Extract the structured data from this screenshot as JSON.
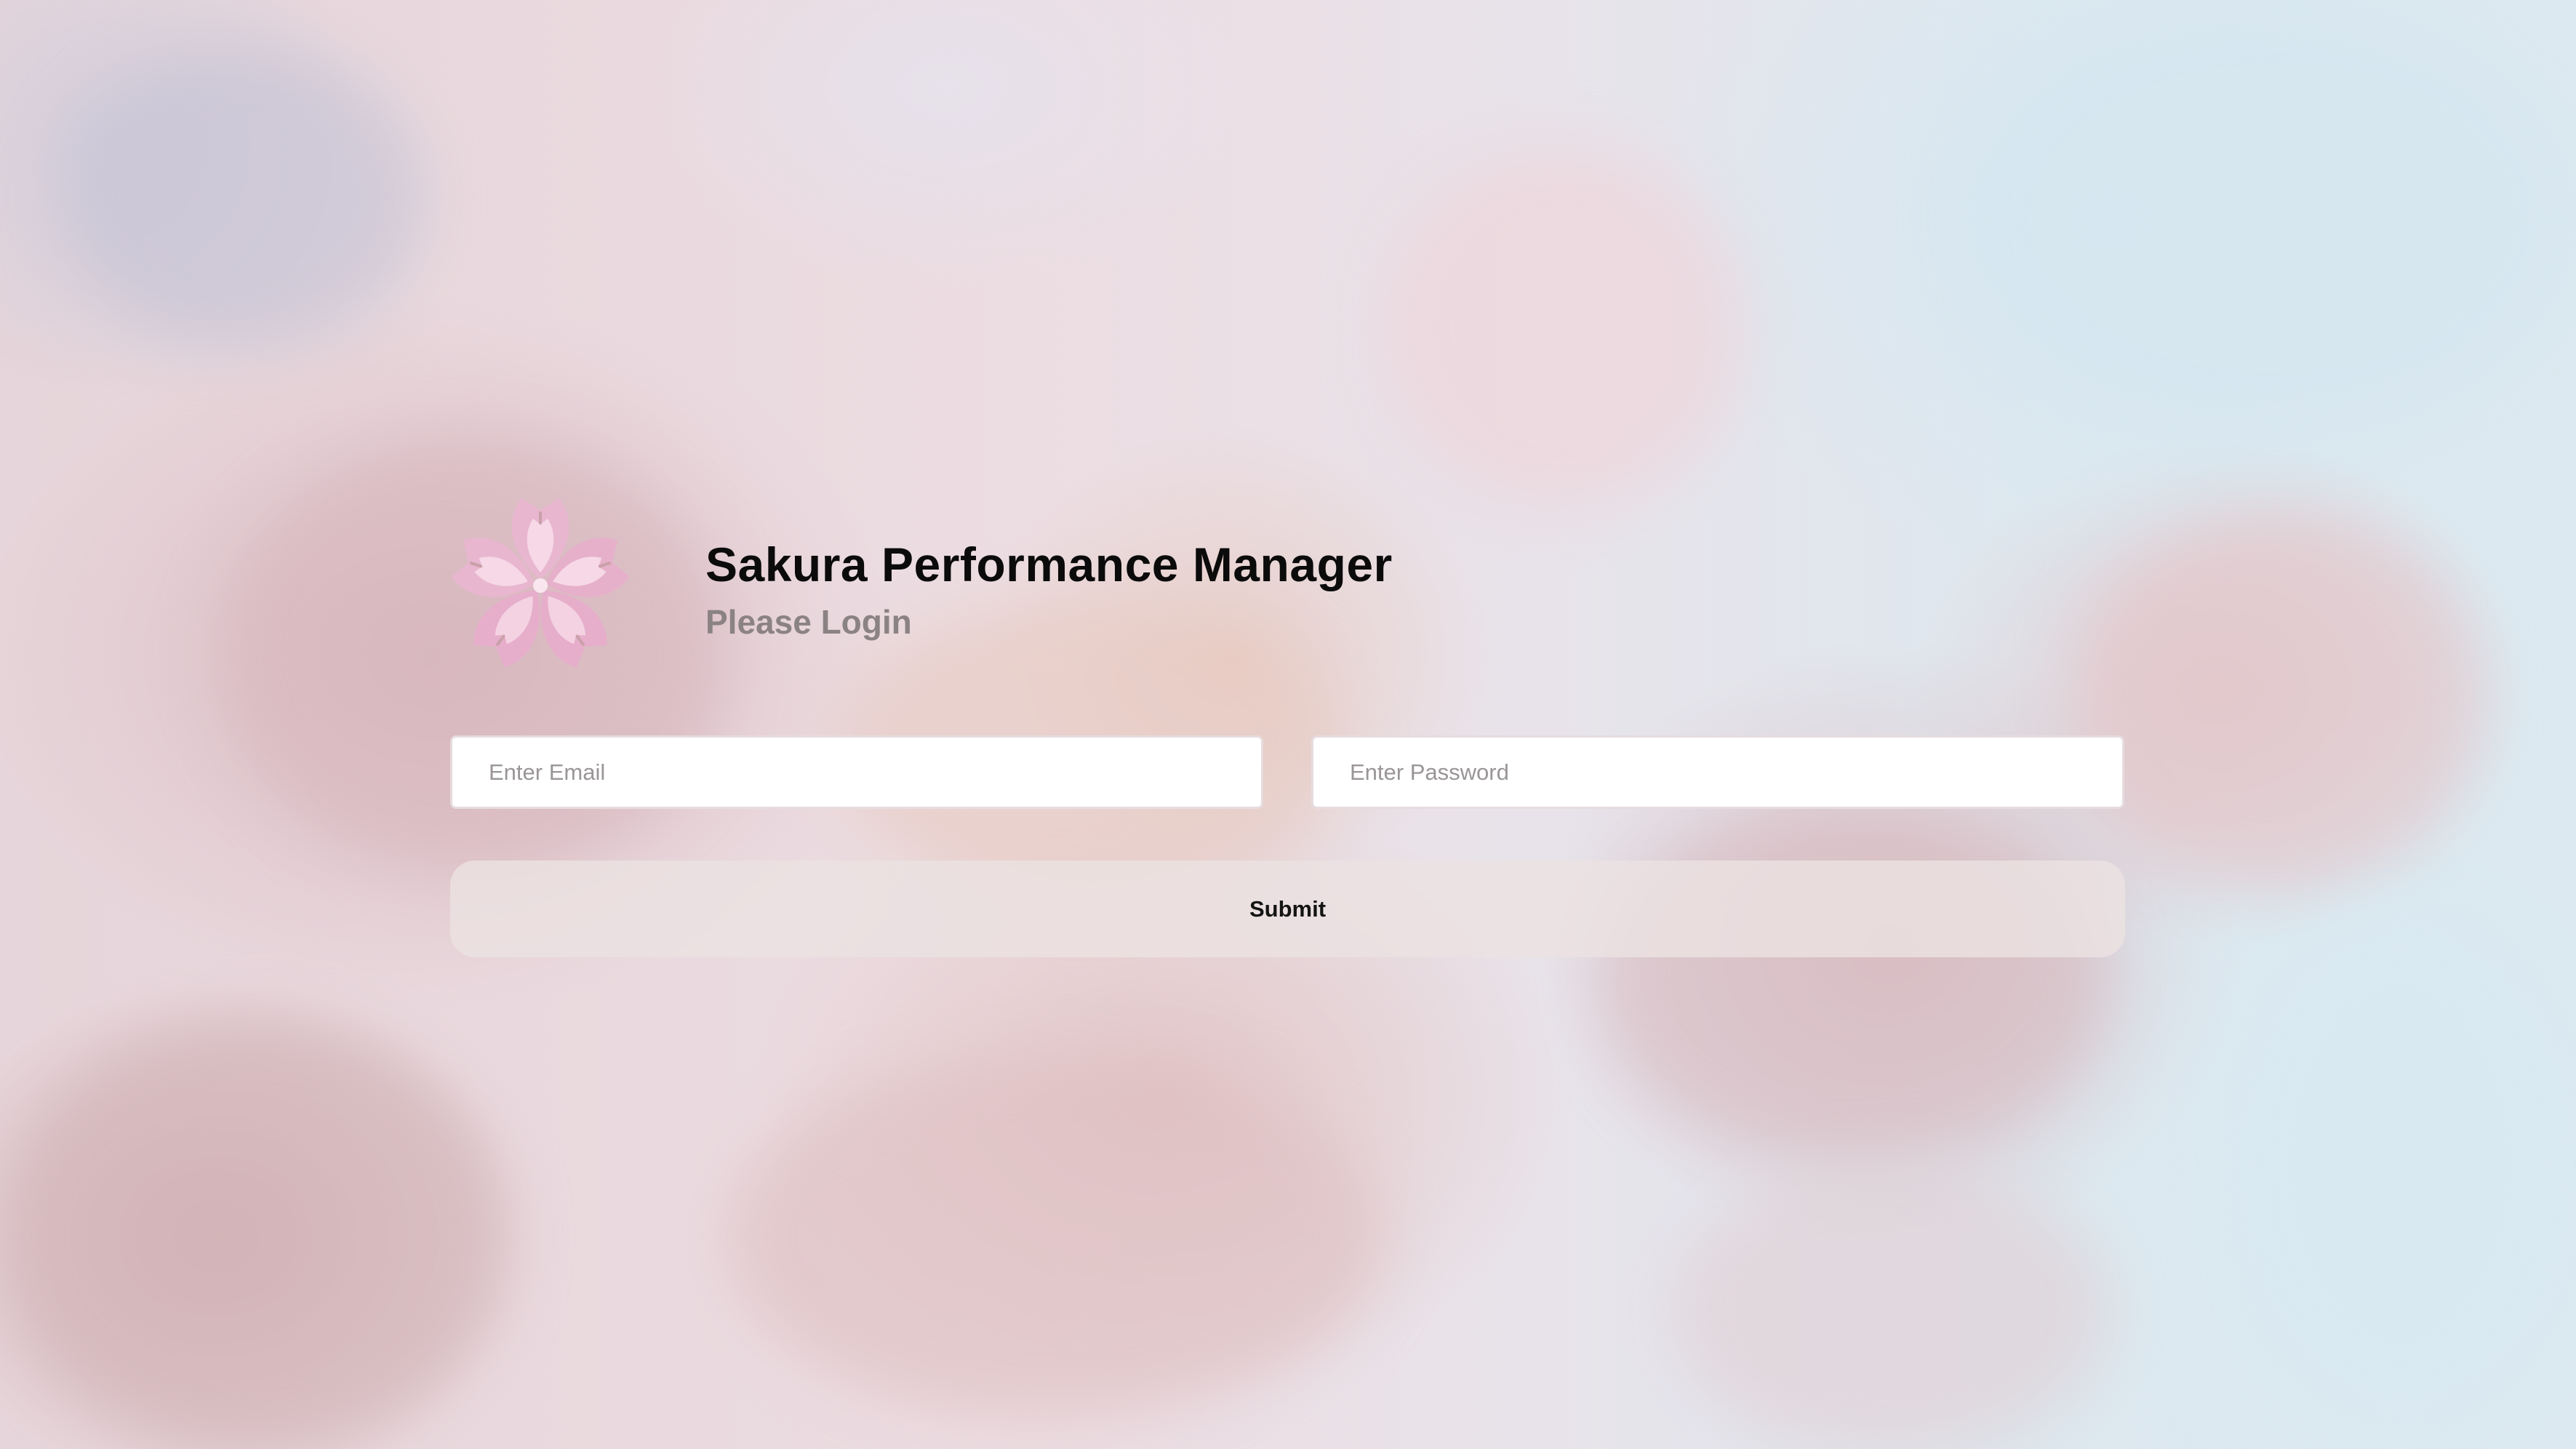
{
  "app": {
    "title": "Sakura Performance Manager",
    "subtitle": "Please Login",
    "logo_icon": "sakura-flower-icon"
  },
  "form": {
    "email_placeholder": "Enter Email",
    "email_value": "",
    "password_placeholder": "Enter Password",
    "password_value": "",
    "submit_label": "Submit"
  },
  "colors": {
    "title": "#0b0b0b",
    "subtitle": "#8b8284",
    "petal_outer": "#e8b6cf",
    "petal_inner": "#f6d8e6",
    "button_bg": "#ece2e2"
  }
}
